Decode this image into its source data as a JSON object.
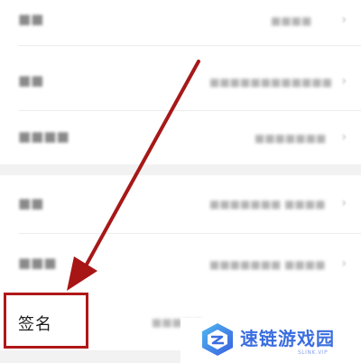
{
  "profile_rows": [
    {
      "label": "签名",
      "value": "这家伙很懒…"
    }
  ],
  "signature": {
    "label": "签名"
  },
  "watermark": {
    "title": "速链游戏园",
    "subtitle": "SLINK.VIP"
  },
  "colors": {
    "highlight": "#b01818",
    "arrow": "#a81515",
    "watermark_blue": "#3a6ee0"
  }
}
